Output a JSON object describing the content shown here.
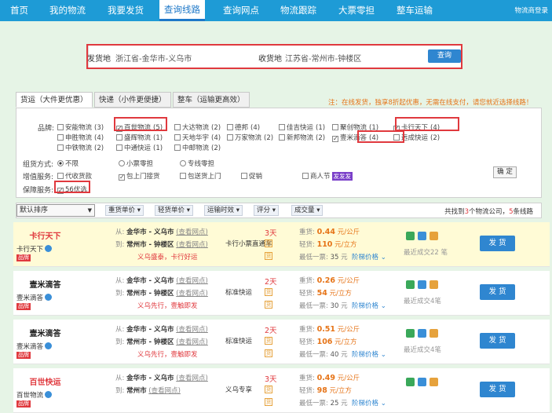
{
  "nav": {
    "items": [
      "首页",
      "我的物流",
      "我要发货",
      "查询线路",
      "查询网点",
      "物流跟踪",
      "大票零担",
      "整车运输"
    ],
    "active_index": 3,
    "login": "物流商登录"
  },
  "search": {
    "from_label": "发货地",
    "from_value": "浙江省-金华市-义乌市",
    "to_label": "收货地",
    "to_value": "江苏省-常州市-钟楼区",
    "button": "查询"
  },
  "tabs": [
    "货运（大件更优惠）",
    "快递（小件更便捷）",
    "整车（运输更高效）"
  ],
  "notice": "注：在线发货，独享8折起优惠，无需在线支付，请您就近选择线路！",
  "filter": {
    "brand_label": "品牌:",
    "brands": [
      {
        "name": "安能物流",
        "count": "(3)",
        "checked": false
      },
      {
        "name": "百世物流",
        "count": "(5)",
        "checked": true
      },
      {
        "name": "大达物流",
        "count": "(2)",
        "checked": false
      },
      {
        "name": "德邦",
        "count": "(4)",
        "checked": false
      },
      {
        "name": "佳吉快运",
        "count": "(1)",
        "checked": false
      },
      {
        "name": "聚创物流",
        "count": "(1)",
        "checked": false
      },
      {
        "name": "卡行天下",
        "count": "(4)",
        "checked": true
      },
      {
        "name": "申胜物流",
        "count": "(4)",
        "checked": false
      },
      {
        "name": "盛辉物流",
        "count": "(1)",
        "checked": false
      },
      {
        "name": "天地华宇",
        "count": "(4)",
        "checked": false
      },
      {
        "name": "万家物流",
        "count": "(2)",
        "checked": false
      },
      {
        "name": "新邦物流",
        "count": "(2)",
        "checked": false
      },
      {
        "name": "壹米滴答",
        "count": "(4)",
        "checked": true
      },
      {
        "name": "远成快运",
        "count": "(2)",
        "checked": false
      },
      {
        "name": "中铁物流",
        "count": "(2)",
        "checked": false
      },
      {
        "name": "中通快运",
        "count": "(1)",
        "checked": false
      },
      {
        "name": "中邮物流",
        "count": "(2)",
        "checked": false
      }
    ],
    "mode_label": "组货方式:",
    "modes": [
      "不限",
      "小票零担",
      "专线零担"
    ],
    "mode_selected": 0,
    "service_label": "增值服务:",
    "services": [
      {
        "name": "代收货款",
        "checked": false
      },
      {
        "name": "包上门接货",
        "checked": true
      },
      {
        "name": "包送货上门",
        "checked": false
      },
      {
        "name": "促销",
        "checked": false
      },
      {
        "name": "商人节",
        "checked": false
      }
    ],
    "new_badge": "发发发",
    "guarantee_label": "保障服务:",
    "guarantee": {
      "name": "56优选",
      "checked": true
    },
    "ok": "确 定"
  },
  "sort": {
    "default": "默认排序",
    "buttons": [
      "重货单价",
      "轻货单价",
      "运输时效",
      "评分",
      "成交量"
    ],
    "info_prefix": "共找到",
    "company_count": "3",
    "info_mid": "个物流公司，",
    "route_count": "5",
    "info_suffix": "条线路"
  },
  "labels": {
    "from": "从:",
    "to": "到:",
    "view_point": "(查看网点)",
    "heavy": "重货:",
    "light": "轻货:",
    "min": "最低一票:",
    "ladder": "阶梯价格",
    "ship": "发 货",
    "brand_tag": "品牌"
  },
  "results": [
    {
      "logo": "卡行天下",
      "logo_color": "#e0393e",
      "name": "卡行天下",
      "from": "金华市 - 义乌市",
      "to": "常州市 - 钟楼区",
      "slogan": "义乌盛泰，卡行好运",
      "days": "3天",
      "vehicle": "卡行小票直通车",
      "heavy": "0.44",
      "heavy_unit": "元/公斤",
      "light": "110",
      "light_unit": "元/立方",
      "min": "35",
      "min_unit": "元",
      "recent": "最近成交22 笔",
      "highlight": true,
      "show_route_link_from": true,
      "show_route_link_to": true
    },
    {
      "logo": "壹米滴答",
      "logo_color": "#222222",
      "name": "壹米滴答",
      "from": "金华市 - 义乌市",
      "to": "常州市 - 钟楼区",
      "slogan": "义乌先行，壹触即发",
      "days": "2天",
      "vehicle": "标准快运",
      "heavy": "0.26",
      "heavy_unit": "元/公斤",
      "light": "54",
      "light_unit": "元/立方",
      "min": "30",
      "min_unit": "元",
      "recent": "最近成交4笔",
      "highlight": false,
      "show_route_link_from": true,
      "show_route_link_to": true
    },
    {
      "logo": "壹米滴答",
      "logo_color": "#222222",
      "name": "壹米滴答",
      "from": "金华市 - 义乌市",
      "to": "常州市 - 钟楼区",
      "slogan": "义乌先行，壹触即发",
      "days": "2天",
      "vehicle": "标准快运",
      "heavy": "0.51",
      "heavy_unit": "元/公斤",
      "light": "106",
      "light_unit": "元/立方",
      "min": "40",
      "min_unit": "元",
      "recent": "最近成交4笔",
      "highlight": false,
      "show_route_link_from": true,
      "show_route_link_to": true
    },
    {
      "logo": "百世快运",
      "logo_color": "#e0393e",
      "name": "百世物流",
      "from": "金华市 - 义乌市",
      "to": "常州市",
      "slogan": "",
      "days": "3天",
      "vehicle": "义乌专享",
      "heavy": "0.49",
      "heavy_unit": "元/公斤",
      "light": "98",
      "light_unit": "元/立方",
      "min": "25",
      "min_unit": "元",
      "recent": "",
      "highlight": false,
      "show_route_link_from": true,
      "show_route_link_to": true
    }
  ]
}
